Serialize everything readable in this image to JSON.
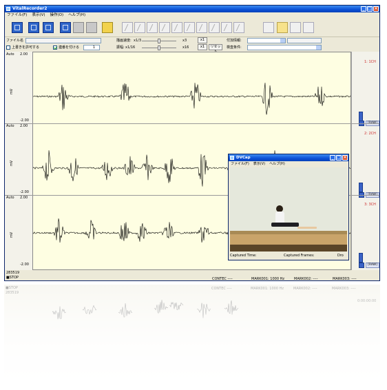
{
  "app": {
    "title": "VitalRecorder2",
    "menu": [
      "ファイル(F)",
      "表示(V)",
      "操作(O)",
      "ヘルプ(H)"
    ]
  },
  "controls": {
    "file_label": "ファイル名",
    "overwrite_label": "上書きを許可する",
    "serial_label": "連番を付ける",
    "serial_value": "1",
    "speed_label": "描画速度:",
    "speed_min": "x1/3",
    "speed_max": "x3",
    "speed_value": "x1",
    "amp_label": "振幅:",
    "amp_min": "x1/16",
    "amp_max": "x16",
    "amp_value": "x1",
    "reset_label": "リセット",
    "info_label": "付加情報:",
    "test_label": "検査条件:"
  },
  "channels": [
    {
      "name": "1: 1CH",
      "auto": "Auto",
      "top": "2.00",
      "bottom": "-2.00",
      "unit": "mV",
      "raw": "[RAW]"
    },
    {
      "name": "2: 2CH",
      "auto": "Auto",
      "top": "2.00",
      "bottom": "-2.00",
      "unit": "mV",
      "raw": "[RAW]"
    },
    {
      "name": "3: 3CH",
      "auto": "Auto",
      "top": "2.00",
      "bottom": "-2.00",
      "unit": "mV",
      "raw": "[RAW]"
    }
  ],
  "status": {
    "counter": "283519",
    "state": "■STOP",
    "contec": "CONTEC ----",
    "marker1": "MARK001: 1000 Hz",
    "marker2": "MARK002: ----",
    "marker3": "MARK003: ----",
    "time": "0:00:00:00"
  },
  "dvcap": {
    "title": "DVCap",
    "menu": [
      "ファイル(F)",
      "表示(V)",
      "ヘルプ(H)"
    ],
    "captured_time": "Captured Time:",
    "captured_frames": "Captured Frames:",
    "dropped": "Dro"
  },
  "colors": {
    "title_bar": "#0a4fd6",
    "chart_bg": "#fefee2",
    "channel_name": "#cc2b2b",
    "signal": "#000000"
  }
}
